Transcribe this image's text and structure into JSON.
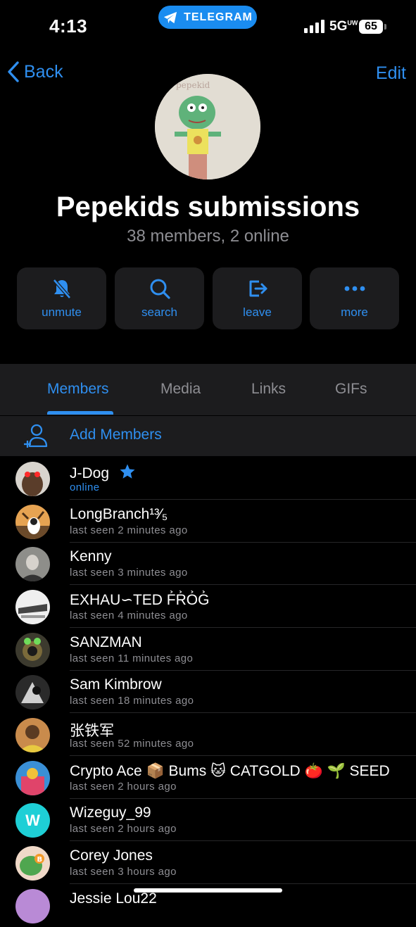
{
  "status_bar": {
    "time": "4:13",
    "pill": "TELEGRAM",
    "network": "5G",
    "network_sup": "UW",
    "battery": "65"
  },
  "nav": {
    "back": "Back",
    "edit": "Edit"
  },
  "group": {
    "name": "Pepekids submissions",
    "subtitle": "38 members, 2 online",
    "avatar_caption": "pepekid"
  },
  "actions": [
    {
      "label": "unmute",
      "icon": "bell-slash-icon"
    },
    {
      "label": "search",
      "icon": "magnifier-icon"
    },
    {
      "label": "leave",
      "icon": "leave-icon"
    },
    {
      "label": "more",
      "icon": "ellipsis-icon"
    }
  ],
  "tabs": [
    "Members",
    "Media",
    "Links",
    "GIFs"
  ],
  "active_tab": "Members",
  "add_members": "Add Members",
  "members": [
    {
      "name": "J-Dog",
      "status": "online",
      "online": true,
      "badge": "star-icon"
    },
    {
      "name": "LongBranch¹³⁄₅",
      "status": "last seen 2 minutes ago"
    },
    {
      "name": "Kenny",
      "status": "last seen 3 minutes ago"
    },
    {
      "name": "EXHAU∽TED F͐R͐O͐G͐",
      "status": "last seen 4 minutes ago"
    },
    {
      "name": "SANZMAN",
      "status": "last seen 11 minutes ago"
    },
    {
      "name": "Sam Kimbrow",
      "status": "last seen 18 minutes ago"
    },
    {
      "name": "张铁军",
      "status": "last seen 52 minutes ago"
    },
    {
      "name": "Crypto Ace 📦 Bums 🐱 CATGOLD 🍅 🌱 SEED",
      "status": "last seen 2 hours ago"
    },
    {
      "name": "Wizeguy_99",
      "status": "last seen 2 hours ago",
      "initial": "W"
    },
    {
      "name": "Corey Jones",
      "status": "last seen 3 hours ago"
    },
    {
      "name": "Jessie Lou22",
      "status": ""
    }
  ],
  "colors": {
    "accent": "#2f8ff0",
    "pill": "#1a8cf0",
    "panel": "#1c1c1e",
    "muted": "#8e8e93",
    "bg": "#000000"
  }
}
